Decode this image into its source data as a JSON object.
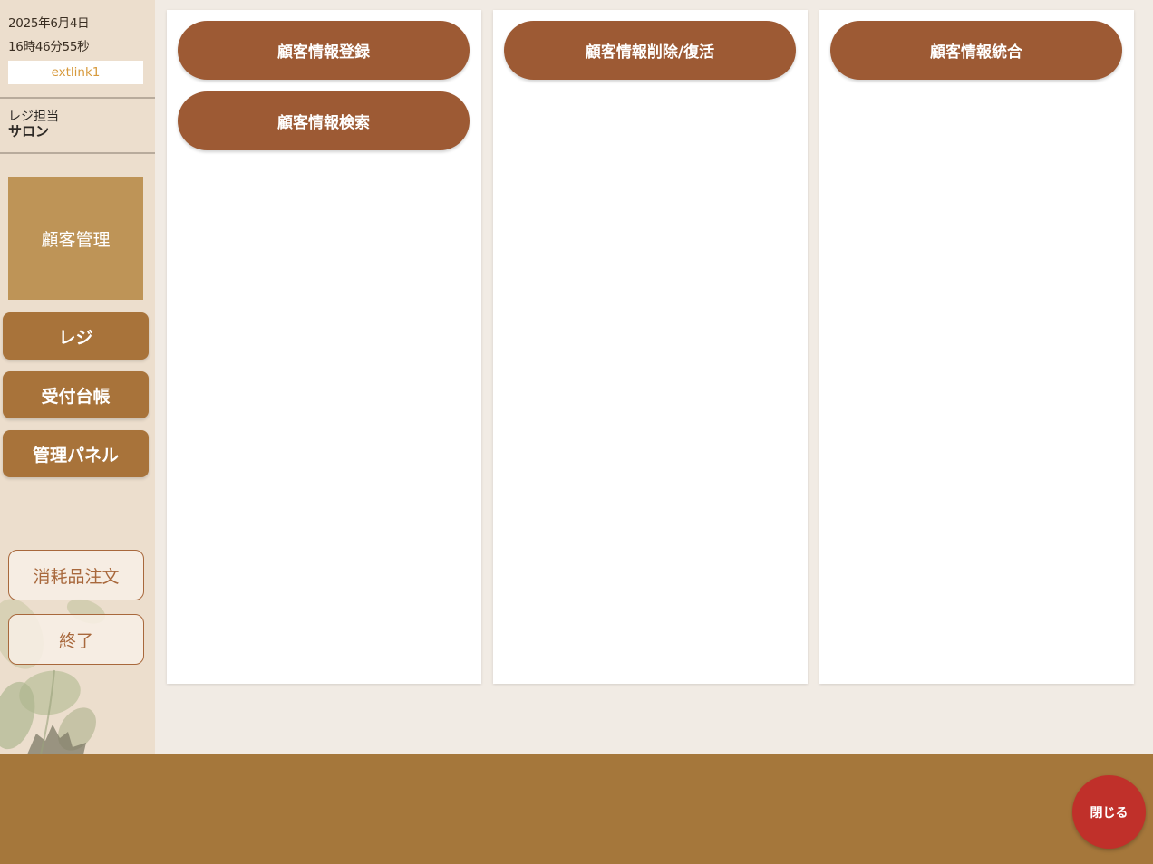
{
  "sidebar": {
    "date": "2025年6月4日",
    "time": "16時46分55秒",
    "user_id": "extlink1",
    "staff_label": "レジ担当",
    "staff_name": "サロン",
    "active_menu": "顧客管理",
    "nav": {
      "regi": "レジ",
      "reception": "受付台帳",
      "admin": "管理パネル"
    },
    "supplies_order": "消耗品注文",
    "exit": "終了"
  },
  "panels": {
    "register": "顧客情報登録",
    "search": "顧客情報検索",
    "delete_restore": "顧客情報削除/復活",
    "merge": "顧客情報統合"
  },
  "footer": {
    "close": "閉じる"
  },
  "colors": {
    "sidebar_bg": "#ecdecd",
    "active_menu": "#be9457",
    "nav_button": "#a8733a",
    "pill_button": "#9d5a34",
    "footer": "#a5773b",
    "close_button": "#c0302a",
    "user_id_text": "#d79a3d"
  },
  "icons": {
    "sidebar_decoration": "leaf-decoration-icon"
  }
}
